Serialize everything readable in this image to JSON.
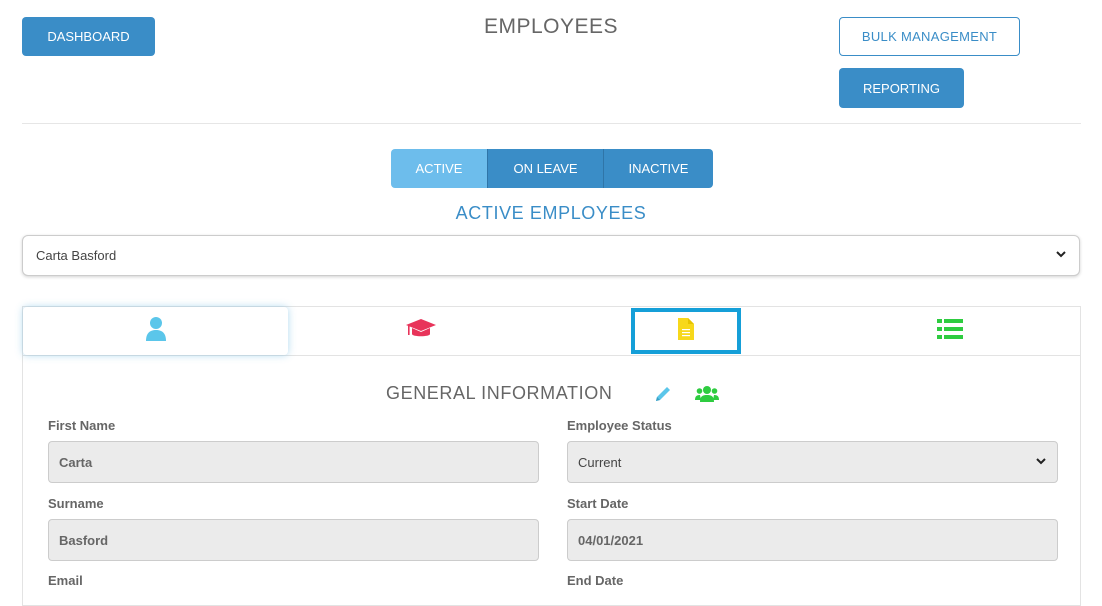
{
  "header": {
    "title": "EMPLOYEES",
    "dashboard_label": "DASHBOARD",
    "bulk_label": "BULK MANAGEMENT",
    "reporting_label": "REPORTING"
  },
  "status_tabs": [
    {
      "label": "ACTIVE",
      "active": true
    },
    {
      "label": "ON LEAVE",
      "active": false
    },
    {
      "label": "INACTIVE",
      "active": false
    }
  ],
  "section_title": "ACTIVE EMPLOYEES",
  "employee_select": {
    "value": "Carta Basford"
  },
  "detail_tabs": [
    {
      "icon": "user-icon",
      "color": "#5bc6ea",
      "selected": true
    },
    {
      "icon": "graduation-cap-icon",
      "color": "#e8345a",
      "selected": false
    },
    {
      "icon": "document-icon",
      "color": "#f7d81b",
      "selected": false
    },
    {
      "icon": "list-icon",
      "color": "#2ecc40",
      "selected": false
    }
  ],
  "general": {
    "title": "GENERAL INFORMATION",
    "edit_icon": "pencil-icon",
    "edit_color": "#5bc6ea",
    "users_icon": "users-icon",
    "users_color": "#2ecc40"
  },
  "fields": {
    "first_name": {
      "label": "First Name",
      "value": "Carta"
    },
    "employee_status": {
      "label": "Employee Status",
      "value": "Current"
    },
    "surname": {
      "label": "Surname",
      "value": "Basford"
    },
    "start_date": {
      "label": "Start Date",
      "value": "04/01/2021"
    },
    "email": {
      "label": "Email"
    },
    "end_date": {
      "label": "End Date"
    }
  },
  "colors": {
    "primary": "#3a8dc7",
    "active_tab": "#6dbdec",
    "highlight": "#159fd8"
  }
}
